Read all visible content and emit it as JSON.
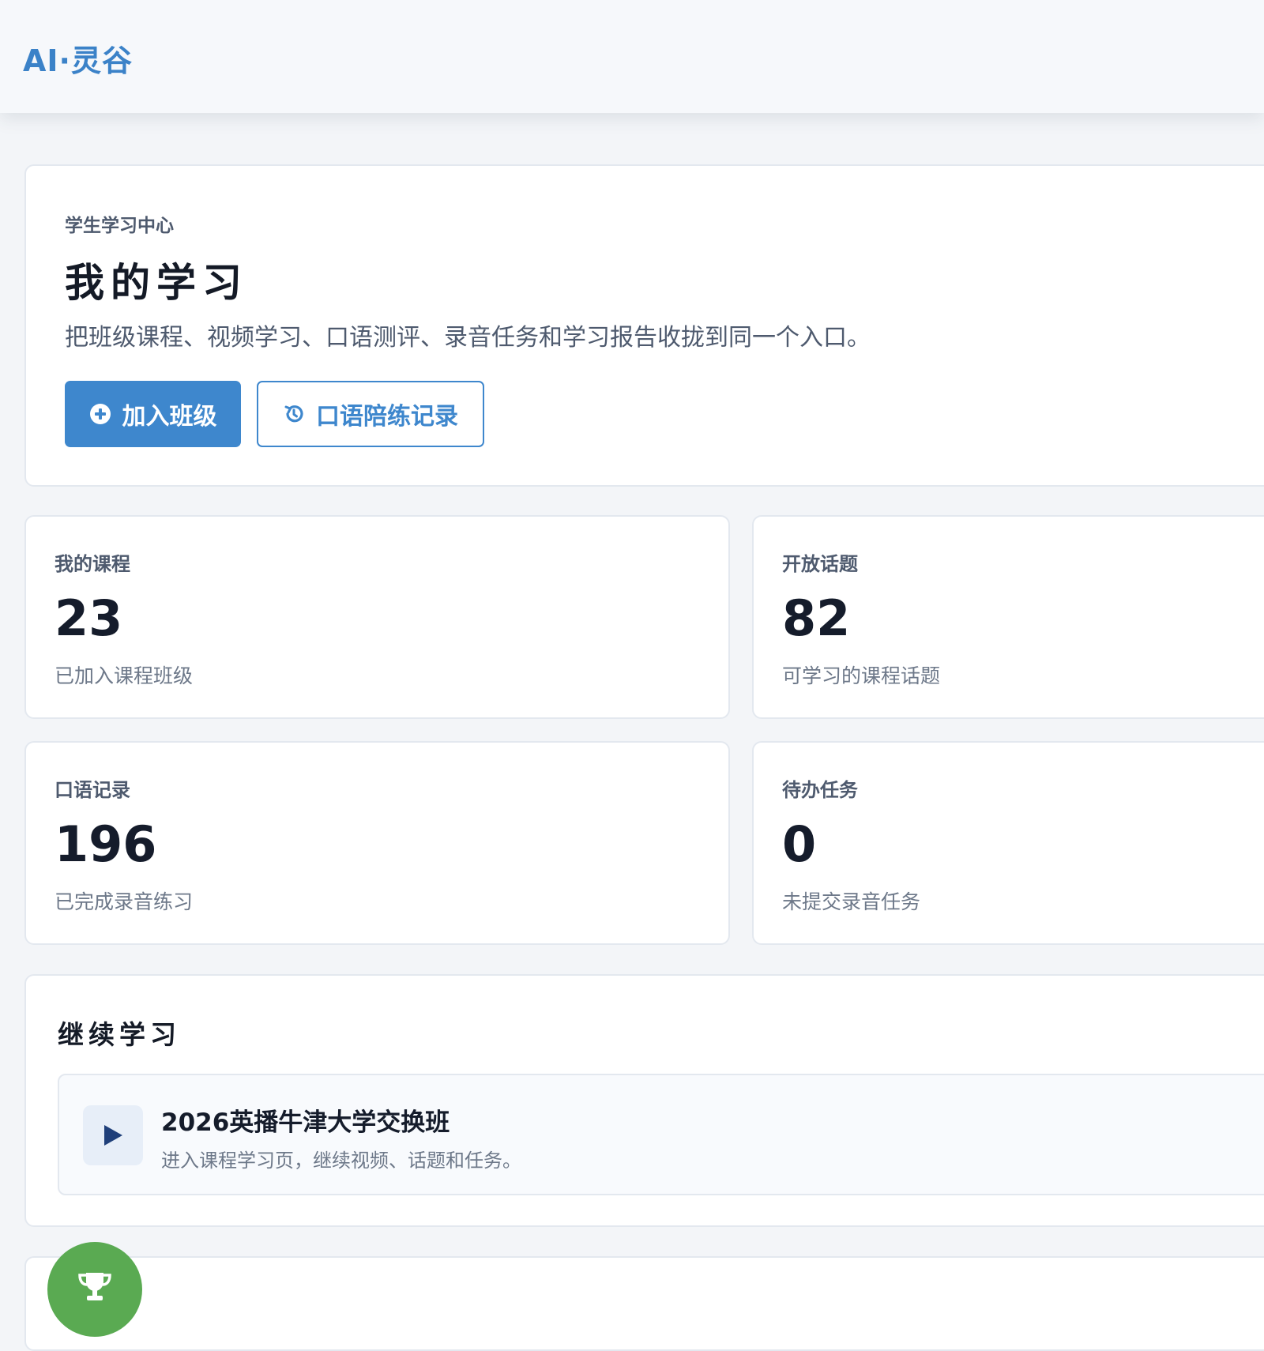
{
  "header": {
    "brand": "AI·灵谷"
  },
  "hero": {
    "eyebrow": "学生学习中心",
    "title": "我的学习",
    "description": "把班级课程、视频学习、口语测评、录音任务和学习报告收拢到同一个入口。",
    "primary_button": {
      "label": "加入班级",
      "icon": "plus-circle-icon"
    },
    "secondary_button": {
      "label": "口语陪练记录",
      "icon": "history-icon"
    }
  },
  "stats": [
    {
      "label": "我的课程",
      "value": "23",
      "sub": "已加入课程班级"
    },
    {
      "label": "开放话题",
      "value": "82",
      "sub": "可学习的课程话题"
    },
    {
      "label": "口语记录",
      "value": "196",
      "sub": "已完成录音练习"
    },
    {
      "label": "待办任务",
      "value": "0",
      "sub": "未提交录音任务"
    }
  ],
  "continue": {
    "title": "继续学习",
    "course": {
      "title": "2026英播牛津大学交换班",
      "description": "进入课程学习页，继续视频、话题和任务。",
      "icon": "play-icon"
    }
  },
  "fab": {
    "icon": "trophy-icon"
  },
  "colors": {
    "accent": "#3e87cd",
    "fab": "#5aaa52",
    "background": "#f3f5f8"
  }
}
